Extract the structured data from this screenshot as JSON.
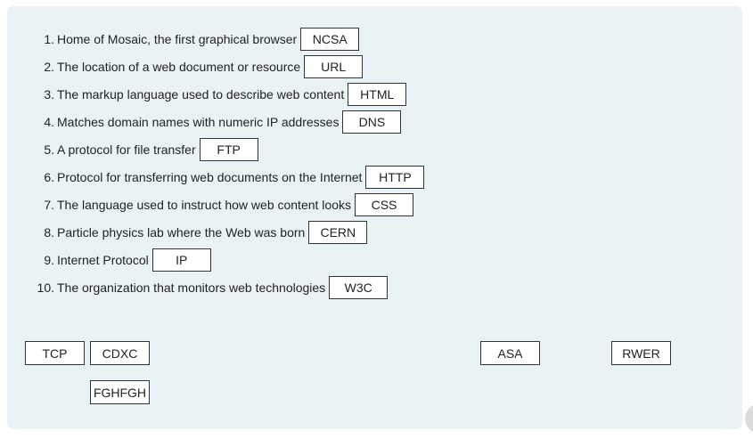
{
  "questions": [
    {
      "num": "1.",
      "text": "Home of Mosaic, the first graphical browser",
      "answer": "NCSA"
    },
    {
      "num": "2.",
      "text": "The location of a web document or resource",
      "answer": "URL"
    },
    {
      "num": "3.",
      "text": "The markup language used to describe web content",
      "answer": "HTML"
    },
    {
      "num": "4.",
      "text": "Matches domain names with numeric IP addresses",
      "answer": "DNS"
    },
    {
      "num": "5.",
      "text": "A protocol for file transfer",
      "answer": "FTP"
    },
    {
      "num": "6.",
      "text": "Protocol for transferring web documents on the Internet",
      "answer": "HTTP"
    },
    {
      "num": "7.",
      "text": "The language used to instruct how web content looks",
      "answer": "CSS"
    },
    {
      "num": "8.",
      "text": "Particle physics lab where the Web was born",
      "answer": "CERN"
    },
    {
      "num": "9.",
      "text": "Internet Protocol",
      "answer": "IP"
    },
    {
      "num": "10.",
      "text": "The organization that monitors web technologies",
      "answer": "W3C"
    }
  ],
  "tokens": {
    "tcp": "TCP",
    "cdxc": "CDXC",
    "asa": "ASA",
    "rwer": "RWER",
    "fghfgh": "FGHFGH"
  }
}
